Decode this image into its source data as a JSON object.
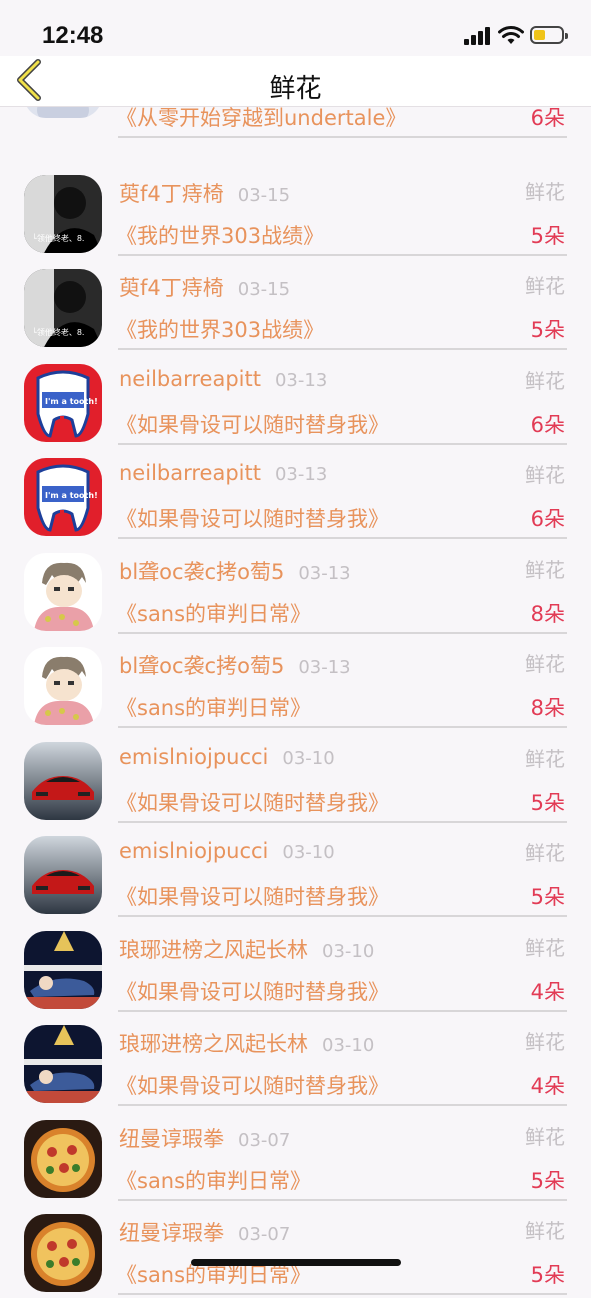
{
  "status_bar": {
    "time": "12:48"
  },
  "nav": {
    "title": "鲜花"
  },
  "rows": [
    {
      "name": "",
      "date": "",
      "tag": "",
      "work": "《从零开始穿越到undertale》",
      "count": "6朵",
      "avatar": "avatar-blank"
    },
    {
      "name": "萸f4丁痔椅",
      "date": "03-15",
      "tag": "鲜花",
      "work": "《我的世界303战绩》",
      "count": "5朵",
      "avatar": "avatar-bw"
    },
    {
      "name": "萸f4丁痔椅",
      "date": "03-15",
      "tag": "鲜花",
      "work": "《我的世界303战绩》",
      "count": "5朵",
      "avatar": "avatar-bw"
    },
    {
      "name": "neilbarreapitt",
      "date": "03-13",
      "tag": "鲜花",
      "work": "《如果骨设可以随时替身我》",
      "count": "6朵",
      "avatar": "avatar-tooth"
    },
    {
      "name": "neilbarreapitt",
      "date": "03-13",
      "tag": "鲜花",
      "work": "《如果骨设可以随时替身我》",
      "count": "6朵",
      "avatar": "avatar-tooth"
    },
    {
      "name": "bl聋oc袭c拷o萄5",
      "date": "03-13",
      "tag": "鲜花",
      "work": "《sans的审判日常》",
      "count": "8朵",
      "avatar": "avatar-anime"
    },
    {
      "name": "bl聋oc袭c拷o萄5",
      "date": "03-13",
      "tag": "鲜花",
      "work": "《sans的审判日常》",
      "count": "8朵",
      "avatar": "avatar-anime"
    },
    {
      "name": "emislniojpucci",
      "date": "03-10",
      "tag": "鲜花",
      "work": "《如果骨设可以随时替身我》",
      "count": "5朵",
      "avatar": "avatar-car"
    },
    {
      "name": "emislniojpucci",
      "date": "03-10",
      "tag": "鲜花",
      "work": "《如果骨设可以随时替身我》",
      "count": "5朵",
      "avatar": "avatar-car"
    },
    {
      "name": "琅琊进榜之风起长林",
      "date": "03-10",
      "tag": "鲜花",
      "work": "《如果骨设可以随时替身我》",
      "count": "4朵",
      "avatar": "avatar-night"
    },
    {
      "name": "琅琊进榜之风起长林",
      "date": "03-10",
      "tag": "鲜花",
      "work": "《如果骨设可以随时替身我》",
      "count": "4朵",
      "avatar": "avatar-night"
    },
    {
      "name": "纽曼谆瑕拳",
      "date": "03-07",
      "tag": "鲜花",
      "work": "《sans的审判日常》",
      "count": "5朵",
      "avatar": "avatar-pizza"
    },
    {
      "name": "纽曼谆瑕拳",
      "date": "03-07",
      "tag": "鲜花",
      "work": "《sans的审判日常》",
      "count": "5朵",
      "avatar": "avatar-pizza"
    }
  ]
}
